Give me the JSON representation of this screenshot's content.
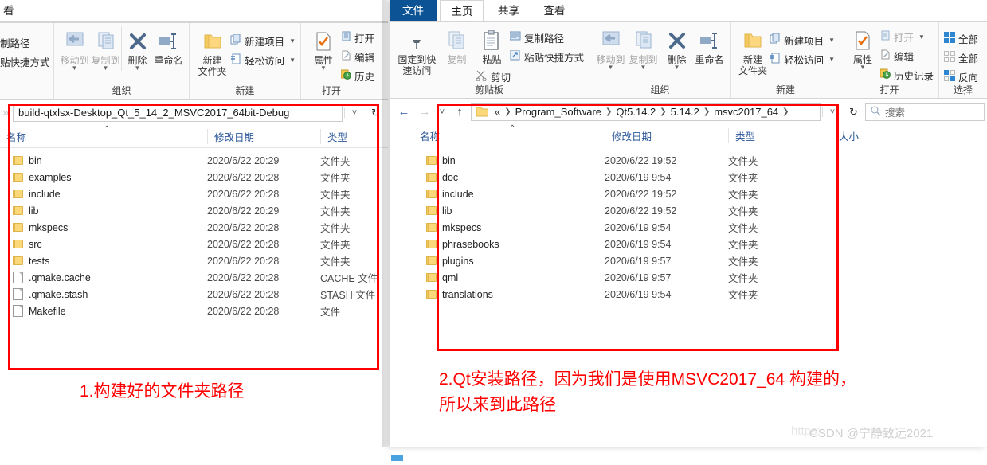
{
  "left_window": {
    "tabs": [
      {
        "label": "看",
        "type": "partial-view-tab"
      }
    ],
    "ribbon": {
      "clipboard_partial": {
        "copy_path": "制路径",
        "paste_shortcut": "贴快捷方式"
      },
      "groups": [
        {
          "title": "组织",
          "buttons": [
            "移动到",
            "复制到",
            "删除",
            "重命名"
          ]
        },
        {
          "title": "新建",
          "big_button": "新建\n文件夹",
          "items": [
            "新建项目",
            "轻松访问"
          ]
        },
        {
          "title": "打开",
          "big_button": "属性",
          "items": [
            "打开",
            "编辑",
            "历史"
          ]
        }
      ]
    },
    "address": {
      "path": "build-qtxlsx-Desktop_Qt_5_14_2_MSVC2017_64bit-Debug",
      "chevron": "chevron-down-icon",
      "refresh": "refresh-icon"
    },
    "columns": [
      "名称",
      "修改日期",
      "类型"
    ],
    "rows": [
      {
        "name": "bin",
        "icon": "folder-icon",
        "date": "2020/6/22 20:29",
        "type": "文件夹"
      },
      {
        "name": "examples",
        "icon": "folder-icon",
        "date": "2020/6/22 20:28",
        "type": "文件夹"
      },
      {
        "name": "include",
        "icon": "folder-icon",
        "date": "2020/6/22 20:28",
        "type": "文件夹"
      },
      {
        "name": "lib",
        "icon": "folder-icon",
        "date": "2020/6/22 20:29",
        "type": "文件夹"
      },
      {
        "name": "mkspecs",
        "icon": "folder-icon",
        "date": "2020/6/22 20:28",
        "type": "文件夹"
      },
      {
        "name": "src",
        "icon": "folder-icon",
        "date": "2020/6/22 20:28",
        "type": "文件夹"
      },
      {
        "name": "tests",
        "icon": "folder-icon",
        "date": "2020/6/22 20:28",
        "type": "文件夹"
      },
      {
        "name": ".qmake.cache",
        "icon": "file-icon",
        "date": "2020/6/22 20:28",
        "type": "CACHE 文件"
      },
      {
        "name": ".qmake.stash",
        "icon": "file-icon",
        "date": "2020/6/22 20:28",
        "type": "STASH 文件"
      },
      {
        "name": "Makefile",
        "icon": "file-icon",
        "date": "2020/6/22 20:28",
        "type": "文件"
      }
    ]
  },
  "right_window": {
    "tabs": [
      {
        "label": "文件",
        "state": "file"
      },
      {
        "label": "主页",
        "state": "active"
      },
      {
        "label": "共享",
        "state": "normal"
      },
      {
        "label": "查看",
        "state": "normal"
      }
    ],
    "ribbon": {
      "groups": [
        {
          "title": "剪贴板",
          "pin": "固定到快\n速访问",
          "copy": "复制",
          "paste": "粘贴",
          "items": [
            "复制路径",
            "粘贴快捷方式",
            "剪切"
          ]
        },
        {
          "title": "组织",
          "buttons": [
            "移动到",
            "复制到",
            "删除",
            "重命名"
          ]
        },
        {
          "title": "新建",
          "big_button": "新建\n文件夹",
          "items": [
            "新建项目",
            "轻松访问"
          ]
        },
        {
          "title": "打开",
          "big_button": "属性",
          "items": [
            "打开",
            "编辑",
            "历史记录"
          ]
        },
        {
          "title": "选择",
          "items": [
            "全部",
            "全部",
            "反向"
          ]
        }
      ]
    },
    "address": {
      "back": "back-arrow-icon",
      "forward": "forward-arrow-icon",
      "recent": "recent-dropdown-icon",
      "up": "up-arrow-icon",
      "crumb_prefix": "«",
      "crumbs": [
        "Program_Software",
        "Qt5.14.2",
        "5.14.2",
        "msvc2017_64"
      ],
      "chevron": "chevron-down-icon",
      "refresh": "refresh-icon",
      "search_placeholder": "搜索"
    },
    "columns": [
      "名称",
      "修改日期",
      "类型",
      "大小"
    ],
    "rows": [
      {
        "name": "bin",
        "icon": "folder-icon",
        "date": "2020/6/22 19:52",
        "type": "文件夹",
        "size": ""
      },
      {
        "name": "doc",
        "icon": "folder-icon",
        "date": "2020/6/19 9:54",
        "type": "文件夹",
        "size": ""
      },
      {
        "name": "include",
        "icon": "folder-icon",
        "date": "2020/6/22 19:52",
        "type": "文件夹",
        "size": ""
      },
      {
        "name": "lib",
        "icon": "folder-icon",
        "date": "2020/6/22 19:52",
        "type": "文件夹",
        "size": ""
      },
      {
        "name": "mkspecs",
        "icon": "folder-icon",
        "date": "2020/6/19 9:54",
        "type": "文件夹",
        "size": ""
      },
      {
        "name": "phrasebooks",
        "icon": "folder-icon",
        "date": "2020/6/19 9:54",
        "type": "文件夹",
        "size": ""
      },
      {
        "name": "plugins",
        "icon": "folder-icon",
        "date": "2020/6/19 9:57",
        "type": "文件夹",
        "size": ""
      },
      {
        "name": "qml",
        "icon": "folder-icon",
        "date": "2020/6/19 9:57",
        "type": "文件夹",
        "size": ""
      },
      {
        "name": "translations",
        "icon": "folder-icon",
        "date": "2020/6/19 9:54",
        "type": "文件夹",
        "size": ""
      }
    ]
  },
  "annotations": {
    "callout_1": "1.构建好的文件夹路径",
    "callout_2_line1": "2.Qt安装路径，因为我们是使用MSVC2017_64 构建的，",
    "callout_2_line2": "所以来到此路径",
    "highlight_color": "#ff0000"
  },
  "watermark": {
    "url": "https:",
    "text": "CSDN @宁静致远2021"
  }
}
